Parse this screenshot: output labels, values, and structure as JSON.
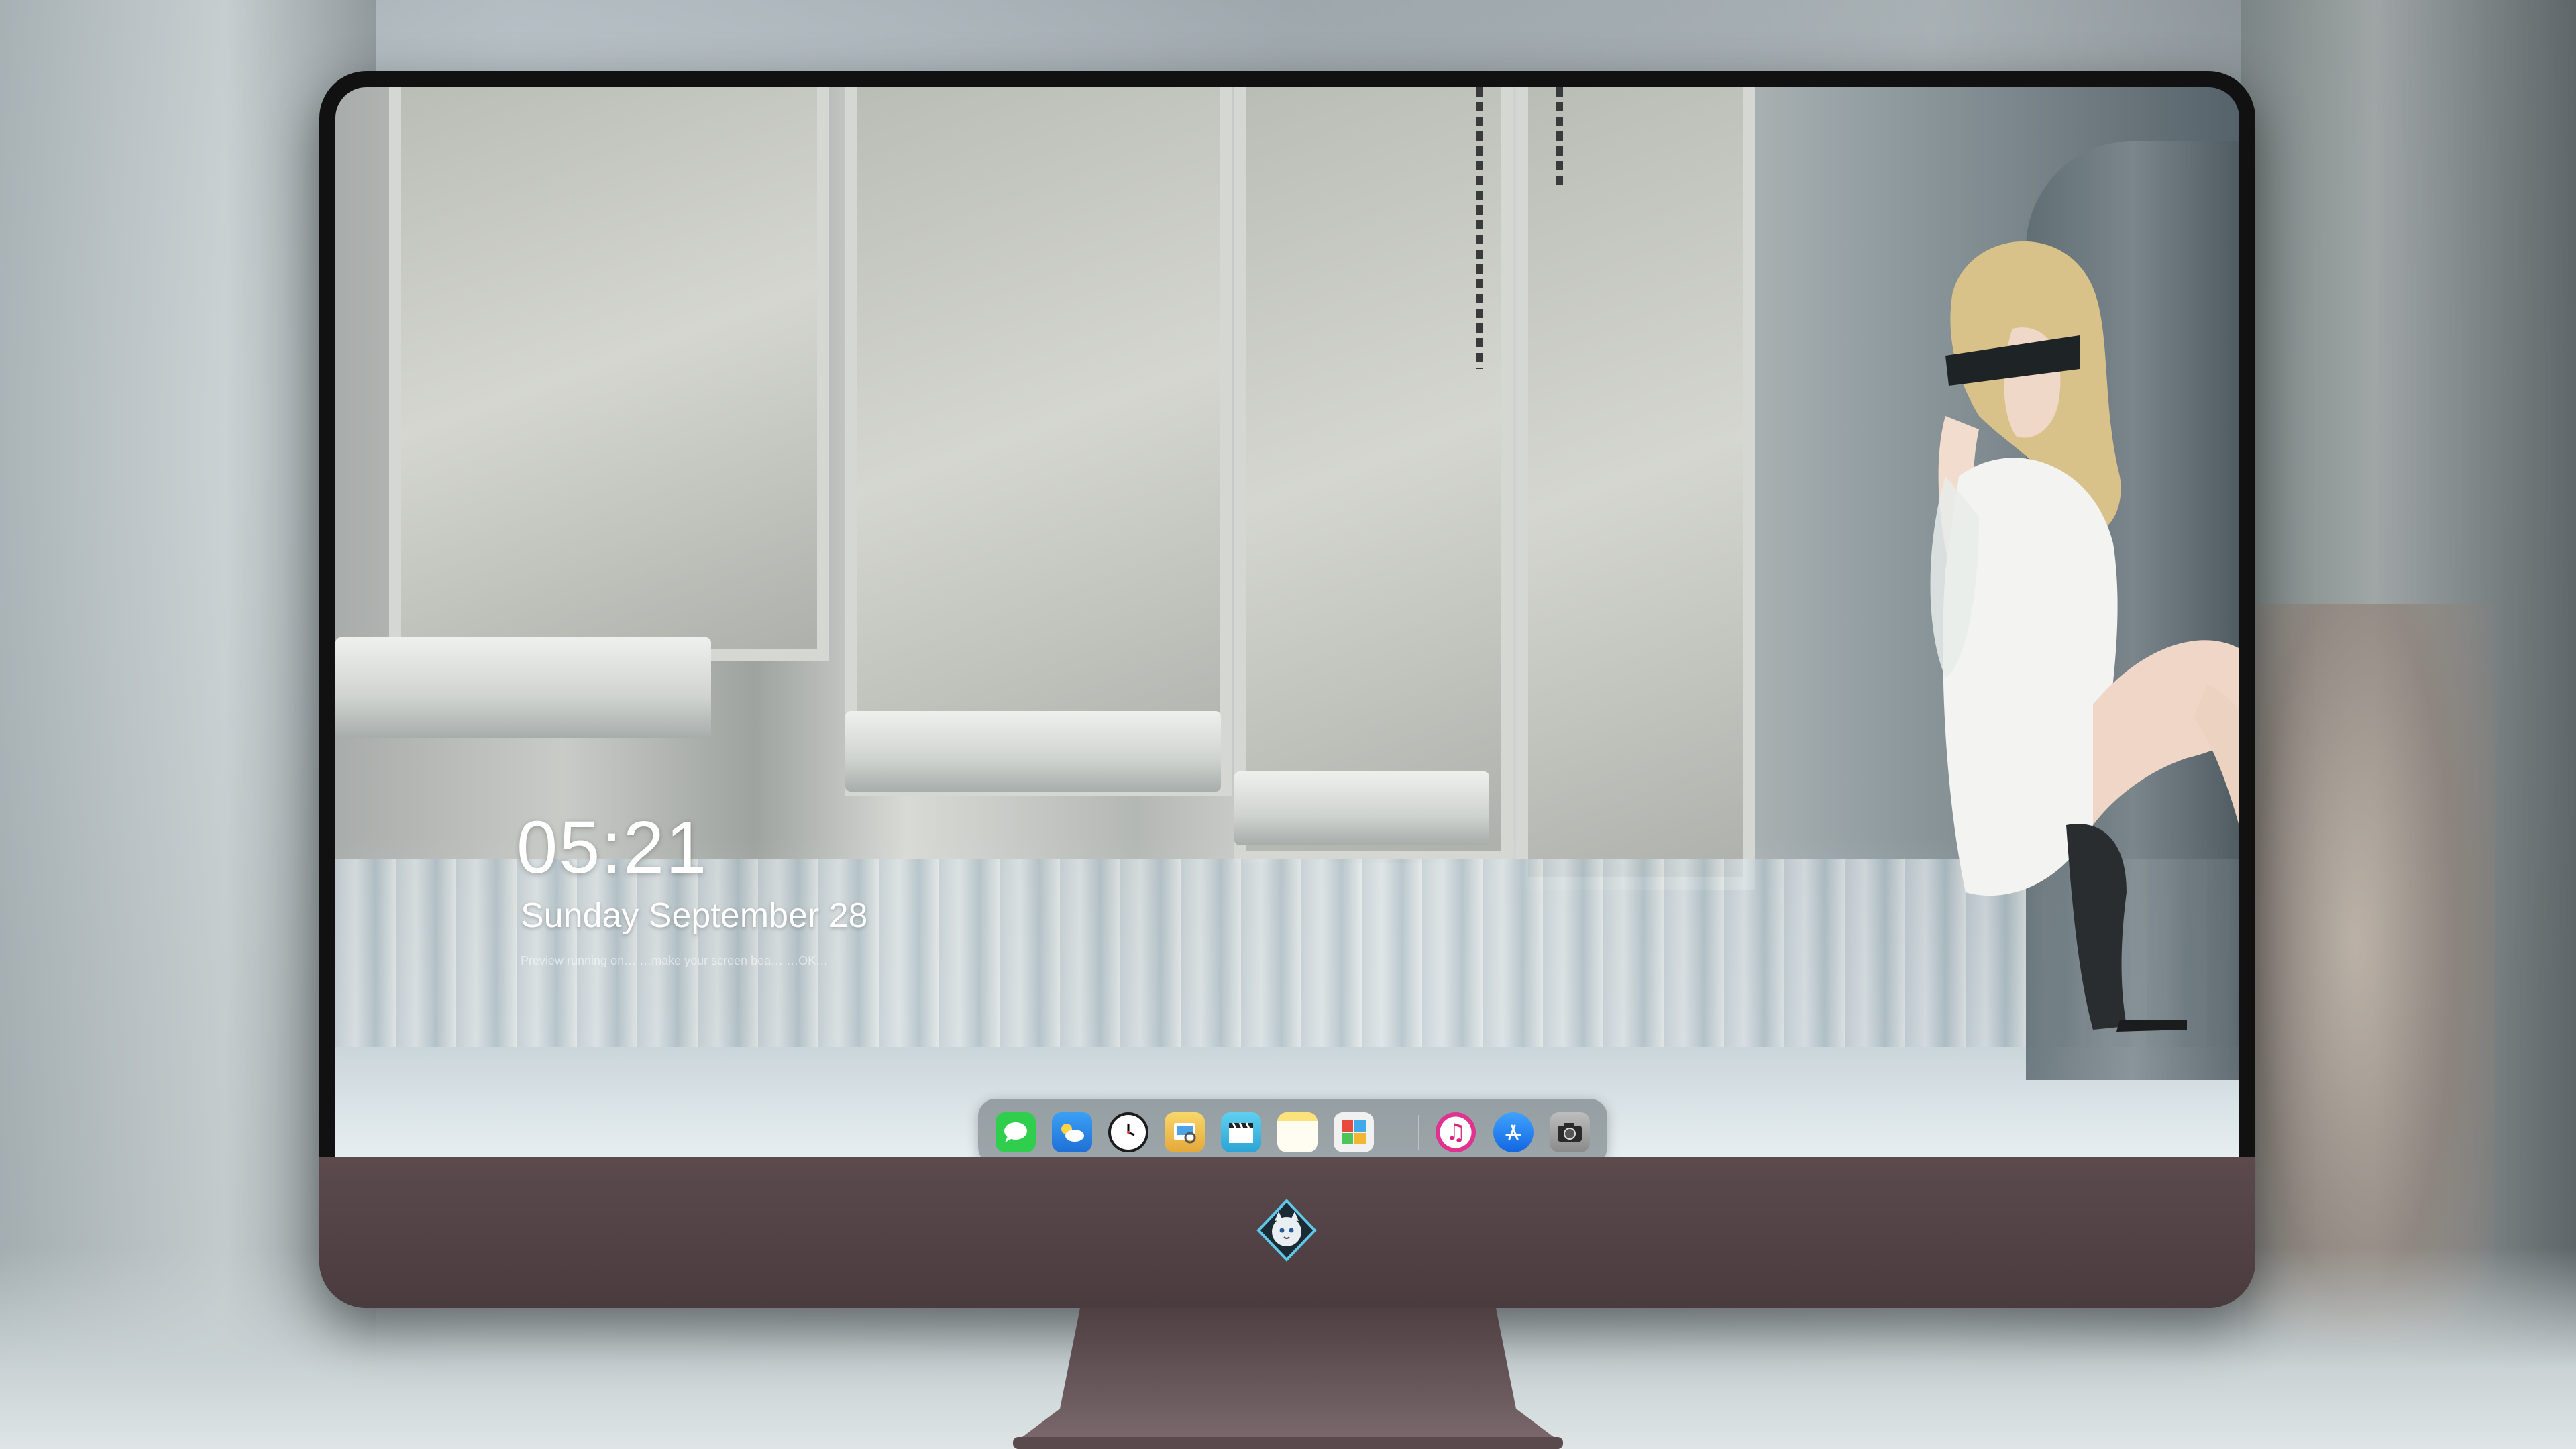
{
  "lock_screen": {
    "time": "05:21",
    "date": "Sunday September  28",
    "preview": "Preview running on…   …make your screen bea…   …OK…"
  },
  "dock": {
    "items": [
      {
        "name": "Messages",
        "icon": "messages-icon",
        "color": "#2fcf4d"
      },
      {
        "name": "Weather",
        "icon": "weather-icon",
        "color": "#2f8ff0"
      },
      {
        "name": "Clock",
        "icon": "clock-icon",
        "color": "#1c1c1c"
      },
      {
        "name": "Preview",
        "icon": "preview-icon",
        "color": "#f2c33a"
      },
      {
        "name": "Clips",
        "icon": "clapperboard-icon",
        "color": "#3db8e0"
      },
      {
        "name": "Notes",
        "icon": "notes-icon",
        "color": "#f5d04a"
      },
      {
        "name": "Photo Booth",
        "icon": "photo-booth-icon",
        "color": "#e6e6e6"
      },
      {
        "name": "iTunes",
        "icon": "music-icon",
        "color": "#e0338f"
      },
      {
        "name": "App Store",
        "icon": "app-store-icon",
        "color": "#2b86ef"
      },
      {
        "name": "Camera",
        "icon": "camera-icon",
        "color": "#3a3a3a"
      }
    ]
  },
  "monitor": {
    "chin_logo": "cat-logo-icon"
  }
}
